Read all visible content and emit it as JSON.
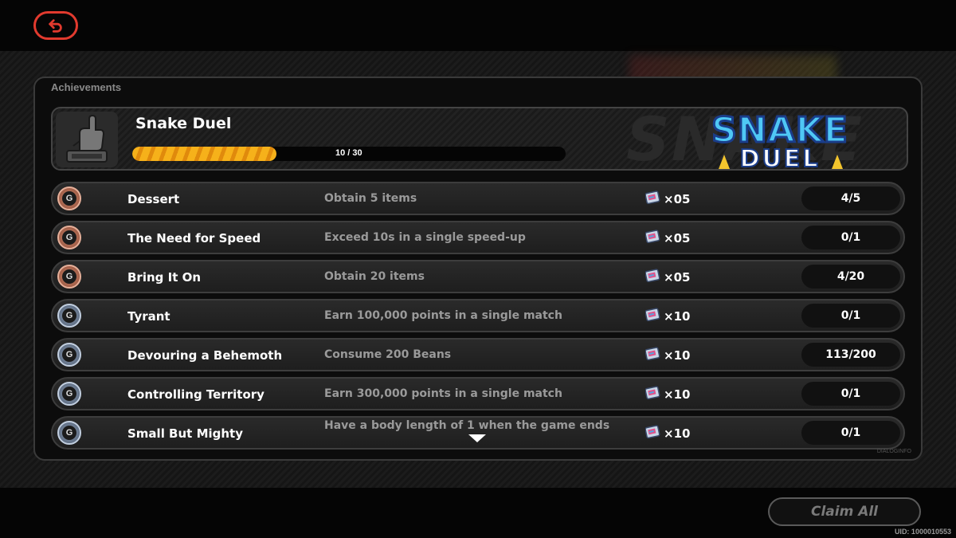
{
  "topbar": {
    "back_icon": "back-arrow-icon",
    "accent_color": "#e23a2e"
  },
  "panel": {
    "title": "Achievements",
    "footer_text": "DIALOGINFO"
  },
  "game": {
    "name": "Snake Duel",
    "progress_text": "10 / 30",
    "progress_fraction": 0.333,
    "logo_line1": "SNAKE",
    "logo_line2": "DUEL",
    "icon": "thumbs-up-trophy-icon"
  },
  "achievements": [
    {
      "tier": "bronze",
      "name": "Dessert",
      "description": "Obtain 5 items",
      "reward": "×05",
      "progress": "4/5"
    },
    {
      "tier": "bronze",
      "name": "The Need for Speed",
      "description": "Exceed 10s in a single speed-up",
      "reward": "×05",
      "progress": "0/1"
    },
    {
      "tier": "bronze",
      "name": "Bring It On",
      "description": "Obtain 20 items",
      "reward": "×05",
      "progress": "4/20"
    },
    {
      "tier": "silver",
      "name": "Tyrant",
      "description": "Earn 100,000 points in a single match",
      "reward": "×10",
      "progress": "0/1"
    },
    {
      "tier": "silver",
      "name": "Devouring a Behemoth",
      "description": "Consume 200 Beans",
      "reward": "×10",
      "progress": "113/200"
    },
    {
      "tier": "silver",
      "name": "Controlling Territory",
      "description": "Earn 300,000 points in a single match",
      "reward": "×10",
      "progress": "0/1"
    },
    {
      "tier": "silver",
      "name": "Small But Mighty",
      "description": "Have a body length of 1 when the game ends",
      "reward": "×10",
      "progress": "0/1"
    }
  ],
  "medal_letter": "G",
  "bottom": {
    "claim_all_label": "Claim All",
    "uid_text": "UID: 1000010553"
  },
  "colors": {
    "progress_fill": "#f6b11a",
    "bronze": "#d08a6e",
    "silver": "#8fa0b8",
    "logo_blue": "#4fc8f5"
  }
}
